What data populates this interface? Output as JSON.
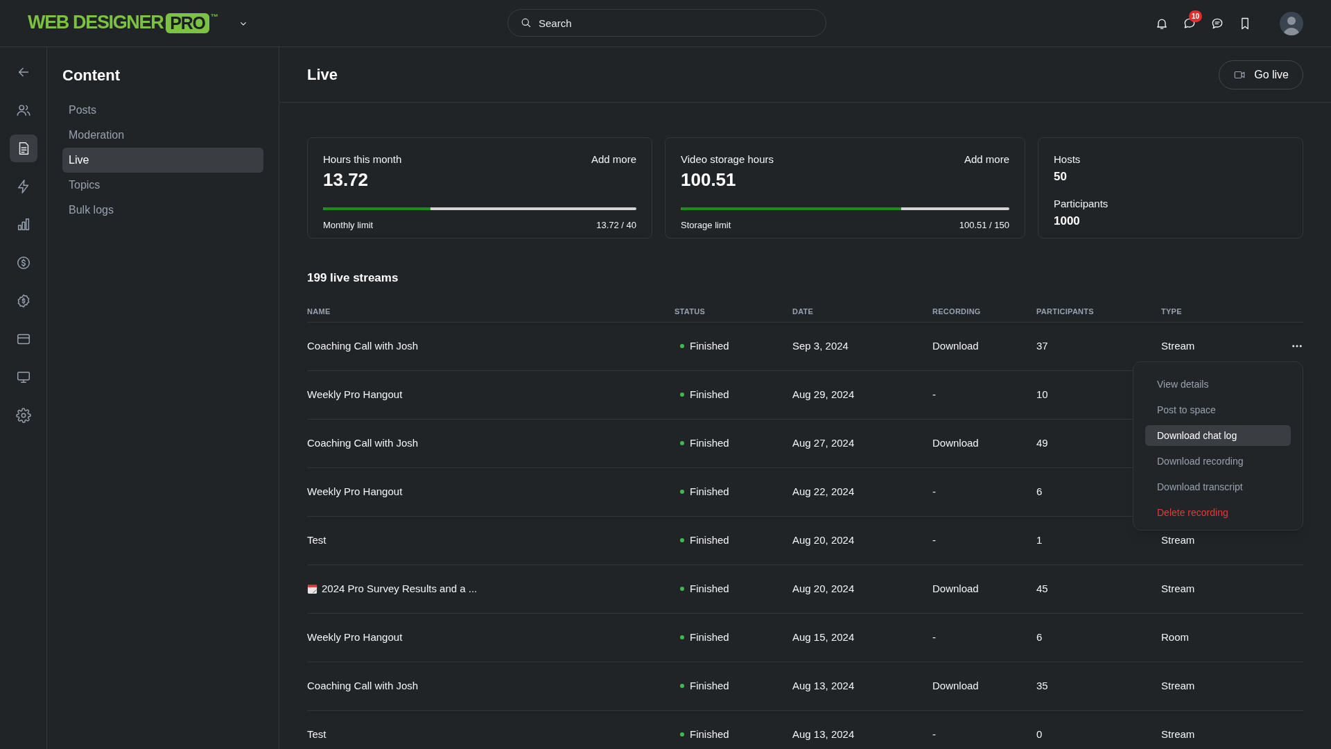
{
  "header": {
    "logo": {
      "text": "WEB DESIGNER",
      "badge": "PRO",
      "mark": "™"
    },
    "search": {
      "placeholder": "Search"
    },
    "messages_badge": "10"
  },
  "rail": {
    "items": [
      {
        "kind": "back",
        "selected": false
      },
      {
        "kind": "users",
        "selected": false
      },
      {
        "kind": "document",
        "selected": true
      },
      {
        "kind": "bolt",
        "selected": false
      },
      {
        "kind": "chart",
        "selected": false
      },
      {
        "kind": "dollar",
        "selected": false
      },
      {
        "kind": "badge",
        "selected": false
      },
      {
        "kind": "card",
        "selected": false
      },
      {
        "kind": "monitor",
        "selected": false
      },
      {
        "kind": "gear",
        "selected": false
      }
    ]
  },
  "sidebar": {
    "title": "Content",
    "items": [
      {
        "label": "Posts",
        "selected": false
      },
      {
        "label": "Moderation",
        "selected": false
      },
      {
        "label": "Live",
        "selected": true
      },
      {
        "label": "Topics",
        "selected": false
      },
      {
        "label": "Bulk logs",
        "selected": false
      }
    ]
  },
  "page": {
    "title": "Live",
    "go_live_button": "Go live"
  },
  "cards": [
    {
      "kind": "meter",
      "title": "Hours this month",
      "action": "Add more",
      "value": "13.72",
      "level": 0.343,
      "limit_label": "Monthly limit",
      "reading": "13.72 / 40"
    },
    {
      "kind": "meter",
      "title": "Video storage hours",
      "action": "Add more",
      "value": "100.51",
      "level": 0.67,
      "limit_label": "Storage limit",
      "reading": "100.51 / 150"
    },
    {
      "kind": "stats",
      "stats": [
        {
          "label": "Hosts",
          "value": "50"
        },
        {
          "label": "Participants",
          "value": "1000"
        }
      ]
    }
  ],
  "table": {
    "title": "199 live streams",
    "columns": [
      "NAME",
      "STATUS",
      "DATE",
      "RECORDING",
      "PARTICIPANTS",
      "TYPE"
    ],
    "rows": [
      {
        "name": "Coaching Call with Josh",
        "status": "Finished",
        "date": "Sep 3, 2024",
        "recording": "Download",
        "participants": "37",
        "type": "Stream"
      },
      {
        "name": "Weekly Pro Hangout",
        "status": "Finished",
        "date": "Aug 29, 2024",
        "recording": "-",
        "participants": "10"
      },
      {
        "name": "Coaching Call with Josh",
        "status": "Finished",
        "date": "Aug 27, 2024",
        "recording": "Download",
        "participants": "49"
      },
      {
        "name": "Weekly Pro Hangout",
        "status": "Finished",
        "date": "Aug 22, 2024",
        "recording": "-",
        "participants": "6"
      },
      {
        "name": "Test",
        "status": "Finished",
        "date": "Aug 20, 2024",
        "recording": "-",
        "participants": "1",
        "type": "Stream"
      },
      {
        "name": "2024 Pro Survey Results and a ...",
        "kind": "calendar",
        "status": "Finished",
        "date": "Aug 20, 2024",
        "recording": "Download",
        "participants": "45",
        "type": "Stream"
      },
      {
        "name": "Weekly Pro Hangout",
        "status": "Finished",
        "date": "Aug 15, 2024",
        "recording": "-",
        "participants": "6",
        "type": "Room"
      },
      {
        "name": "Coaching Call with Josh",
        "status": "Finished",
        "date": "Aug 13, 2024",
        "recording": "Download",
        "participants": "35",
        "type": "Stream"
      },
      {
        "name": "Test",
        "status": "Finished",
        "date": "Aug 13, 2024",
        "recording": "-",
        "participants": "0",
        "type": "Stream"
      }
    ]
  },
  "row_menu": {
    "items": [
      {
        "label": "View details",
        "kind": "normal",
        "selected": false
      },
      {
        "label": "Post to space",
        "kind": "normal",
        "selected": false
      },
      {
        "label": "Download chat log",
        "kind": "normal",
        "selected": true
      },
      {
        "label": "Download recording",
        "kind": "normal",
        "selected": false
      },
      {
        "label": "Download transcript",
        "kind": "normal",
        "selected": false
      },
      {
        "label": "Delete recording",
        "kind": "danger",
        "selected": false
      }
    ]
  }
}
